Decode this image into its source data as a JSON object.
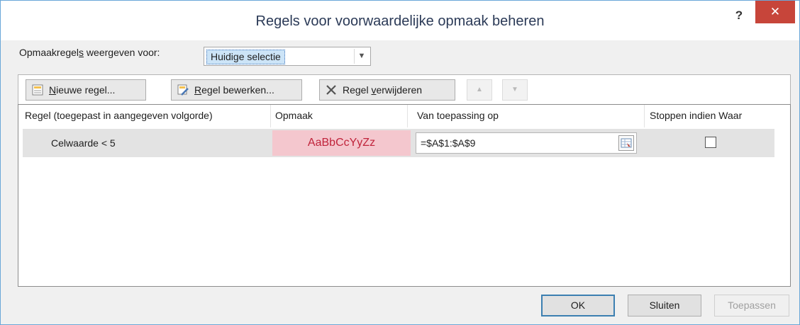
{
  "dialog": {
    "title": "Regels voor voorwaardelijke opmaak beheren",
    "help_label": "?",
    "close_label": "✕"
  },
  "show_rules": {
    "label_pre": "Opmaakregel",
    "label_ul": "s",
    "label_post": " weergeven voor:",
    "selected": "Huidige selectie"
  },
  "toolbar": {
    "new_ul": "N",
    "new_rest": "ieuwe regel...",
    "edit_ul": "R",
    "edit_rest": "egel bewerken...",
    "delete_pre": "Regel ",
    "delete_ul": "v",
    "delete_rest": "erwijderen",
    "move_up": "▲",
    "move_down": "▼"
  },
  "table": {
    "headers": [
      "Regel (toegepast in aangegeven volgorde)",
      "Opmaak",
      "Van toepassing op",
      "Stoppen indien Waar"
    ],
    "rows": [
      {
        "rule": "Celwaarde < 5",
        "format_preview": "AaBbCcYyZz",
        "applies_to": "=$A$1:$A$9",
        "stop_if_true": false
      }
    ]
  },
  "buttons": {
    "ok": "OK",
    "close": "Sluiten",
    "apply": "Toepassen"
  },
  "colors": {
    "format_fill": "#f4c7ce",
    "format_font": "#c0243b",
    "close_button": "#c7453a"
  }
}
